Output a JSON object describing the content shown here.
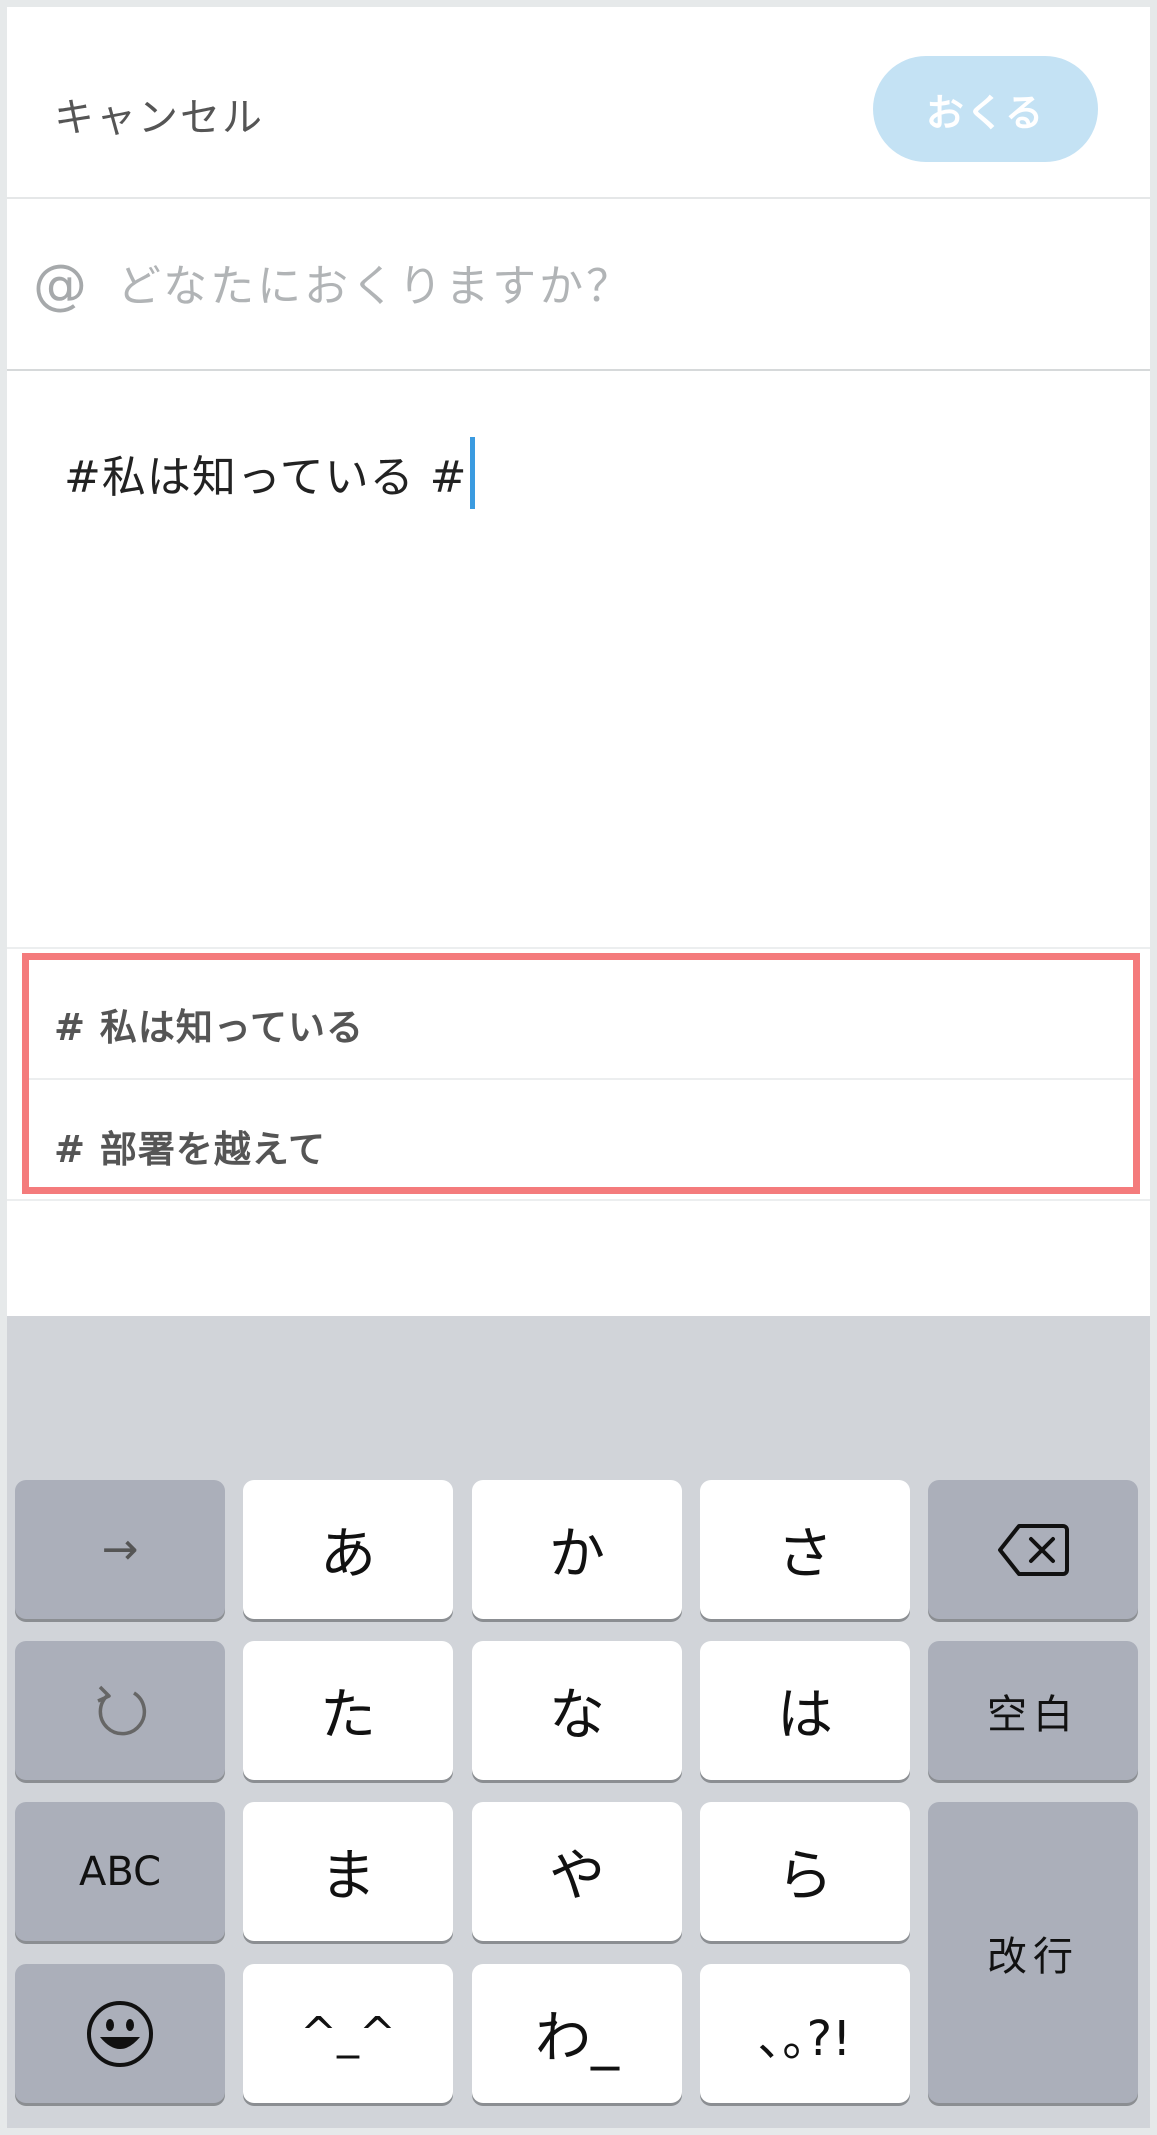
{
  "header": {
    "cancel_label": "キャンセル",
    "send_label": "おくる"
  },
  "recipient": {
    "at_symbol": "@",
    "placeholder": "どなたにおくりますか？"
  },
  "message": {
    "text": "#私は知っている #"
  },
  "suggestions": [
    {
      "label": "# 私は知っている"
    },
    {
      "label": "# 部署を越えて"
    }
  ],
  "keyboard": {
    "rows": [
      [
        "→",
        "あ",
        "か",
        "さ",
        "delete-icon"
      ],
      [
        "undo-icon",
        "た",
        "な",
        "は",
        "空白"
      ],
      [
        "ABC",
        "ま",
        "や",
        "ら",
        "改行"
      ],
      [
        "emoji-icon",
        "^_^",
        "わ_",
        "､｡?!"
      ]
    ],
    "labels": {
      "arrow": "→",
      "a": "あ",
      "ka": "か",
      "sa": "さ",
      "ta": "た",
      "na": "な",
      "ha": "は",
      "space": "空白",
      "abc": "ABC",
      "ma": "ま",
      "ya": "や",
      "ra": "ら",
      "enter": "改行",
      "kaomoji": "^_^",
      "wa": "わ_",
      "punct": "､｡?!"
    }
  },
  "colors": {
    "send_button_bg": "#c4e2f4",
    "highlight_border": "#f47b7c",
    "caret": "#3b9be0",
    "keyboard_bg": "#d1d4d9",
    "dark_key": "#abafba"
  }
}
